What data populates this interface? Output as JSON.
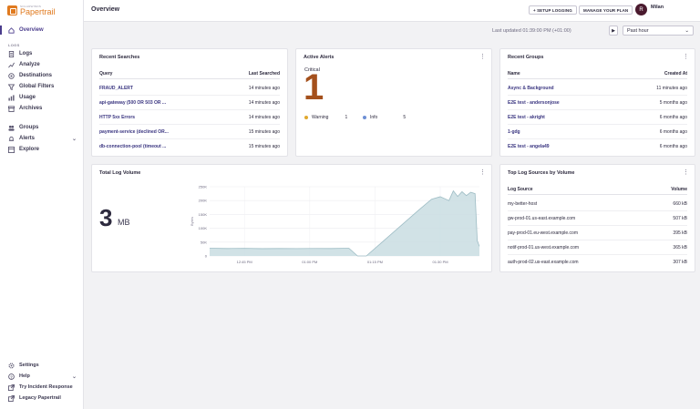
{
  "app": {
    "brand_small": "SOLARWINDS",
    "brand_name": "Papertrail"
  },
  "sidebar": {
    "overview": "Overview",
    "section_logs": "LOGS",
    "items": [
      {
        "label": "Logs",
        "icon": "document-icon"
      },
      {
        "label": "Analyze",
        "icon": "chart-icon"
      },
      {
        "label": "Destinations",
        "icon": "target-icon"
      },
      {
        "label": "Global Filters",
        "icon": "filter-icon"
      },
      {
        "label": "Usage",
        "icon": "gauge-icon"
      },
      {
        "label": "Archives",
        "icon": "archive-icon"
      }
    ],
    "groups": "Groups",
    "alerts": "Alerts",
    "explore": "Explore",
    "bottom": {
      "settings": "Settings",
      "help": "Help",
      "try_incident": "Try Incident Response",
      "legacy": "Legacy Papertrail"
    }
  },
  "header": {
    "title": "Overview",
    "setup_logging": "+ SETUP LOGGING",
    "manage_plan": "MANAGE YOUR PLAN",
    "avatar_initial": "R",
    "user_name": "Milan"
  },
  "toolbar": {
    "last_updated": "Last updated 01:39:00 PM (+01:00)",
    "range": "Past hour"
  },
  "recent_searches": {
    "title": "Recent Searches",
    "col_query": "Query",
    "col_last": "Last Searched",
    "rows": [
      {
        "query": "FRAUD_ALERT",
        "when": "14 minutes ago"
      },
      {
        "query": "api-gateway (500 OR 503 OR ...",
        "when": "14 minutes ago"
      },
      {
        "query": "HTTP 5xx Errors",
        "when": "14 minutes ago"
      },
      {
        "query": "payment-service (declined OR...",
        "when": "15 minutes ago"
      },
      {
        "query": "db-connection-pool (timeout ...",
        "when": "15 minutes ago"
      }
    ]
  },
  "active_alerts": {
    "title": "Active Alerts",
    "critical_label": "Critical",
    "critical_count": "1",
    "warning_label": "Warning",
    "warning_count": "1",
    "info_label": "Info",
    "info_count": "5",
    "warning_color": "#e0a82e",
    "info_color": "#6d8fd4"
  },
  "recent_groups": {
    "title": "Recent Groups",
    "col_name": "Name",
    "col_created": "Created At",
    "rows": [
      {
        "name": "Async & Background",
        "created": "11 minutes ago"
      },
      {
        "name": "E2E test - andersonjose",
        "created": "5 months ago"
      },
      {
        "name": "E2E test - akright",
        "created": "6 months ago"
      },
      {
        "name": "1-gdg",
        "created": "6 months ago"
      },
      {
        "name": "E2E test - angela49",
        "created": "6 months ago"
      }
    ]
  },
  "log_volume": {
    "title": "Total Log Volume",
    "value": "3",
    "unit": "MB"
  },
  "chart_data": {
    "type": "area",
    "title": "",
    "xlabel": "",
    "ylabel": "Bytes",
    "x_ticks": [
      "12:45 PM",
      "01:00 PM",
      "01:15 PM",
      "01:30 PM"
    ],
    "y_ticks": [
      "0",
      "50K",
      "100K",
      "150K",
      "200K",
      "250K"
    ],
    "ylim": [
      0,
      250000
    ],
    "x_minutes": [
      0,
      4,
      8,
      12,
      16,
      20,
      24,
      28,
      32,
      34,
      36,
      40,
      44,
      48,
      51,
      53,
      55,
      56,
      57,
      58,
      59,
      60,
      61,
      61.5,
      62
    ],
    "values": [
      28000,
      27000,
      27500,
      26500,
      27000,
      26800,
      27200,
      26900,
      28000,
      0,
      0,
      55000,
      110000,
      165000,
      205000,
      214000,
      200000,
      235000,
      215000,
      232000,
      218000,
      230000,
      225000,
      55000,
      35000
    ],
    "fill_color": "#c9dde2",
    "line_color": "#9dbcc4",
    "grid": true
  },
  "top_sources": {
    "title": "Top Log Sources by Volume",
    "col_source": "Log Source",
    "col_volume": "Volume",
    "rows": [
      {
        "source": "my-better-host",
        "volume": "660 kB"
      },
      {
        "source": "gw-prod-01.us-east.example.com",
        "volume": "507 kB"
      },
      {
        "source": "pay-prod-01.eu-west.example.com",
        "volume": "395 kB"
      },
      {
        "source": "notif-prod-01.us-west.example.com",
        "volume": "365 kB"
      },
      {
        "source": "auth-prod-02.us-east.example.com",
        "volume": "307 kB"
      }
    ]
  }
}
